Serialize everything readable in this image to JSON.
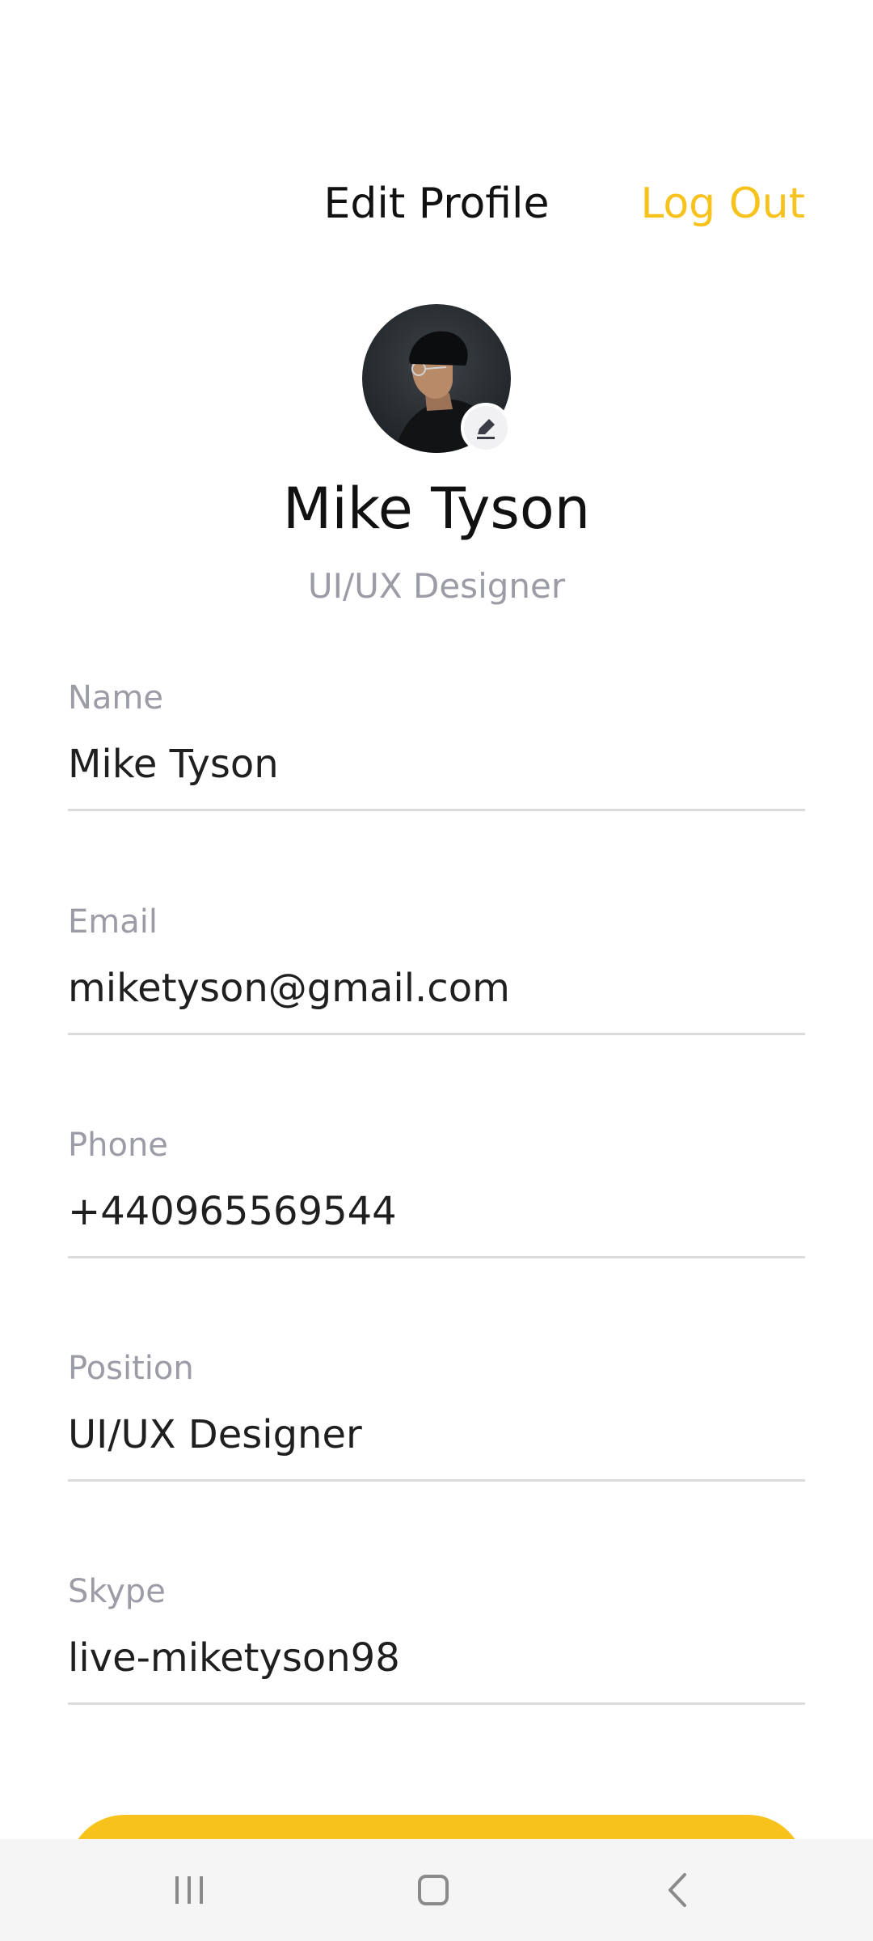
{
  "header": {
    "title": "Edit Profile",
    "logout_label": "Log Out"
  },
  "profile": {
    "avatar_icon": "avatar-photo",
    "edit_icon": "pencil-icon",
    "name": "Mike Tyson",
    "role": "UI/UX Designer"
  },
  "fields": [
    {
      "label": "Name",
      "value": "Mike Tyson"
    },
    {
      "label": "Email",
      "value": "miketyson@gmail.com"
    },
    {
      "label": "Phone",
      "value": "+440965569544"
    },
    {
      "label": "Position",
      "value": "UI/UX Designer"
    },
    {
      "label": "Skype",
      "value": "live-miketyson98"
    }
  ],
  "nav": {
    "recents_icon": "recents-icon",
    "home_icon": "home-icon",
    "back_icon": "back-icon"
  },
  "colors": {
    "accent": "#f8c21c",
    "label_gray": "#9b9ca6",
    "divider": "#dcdcdc",
    "navbar_bg": "#f5f5f5"
  }
}
